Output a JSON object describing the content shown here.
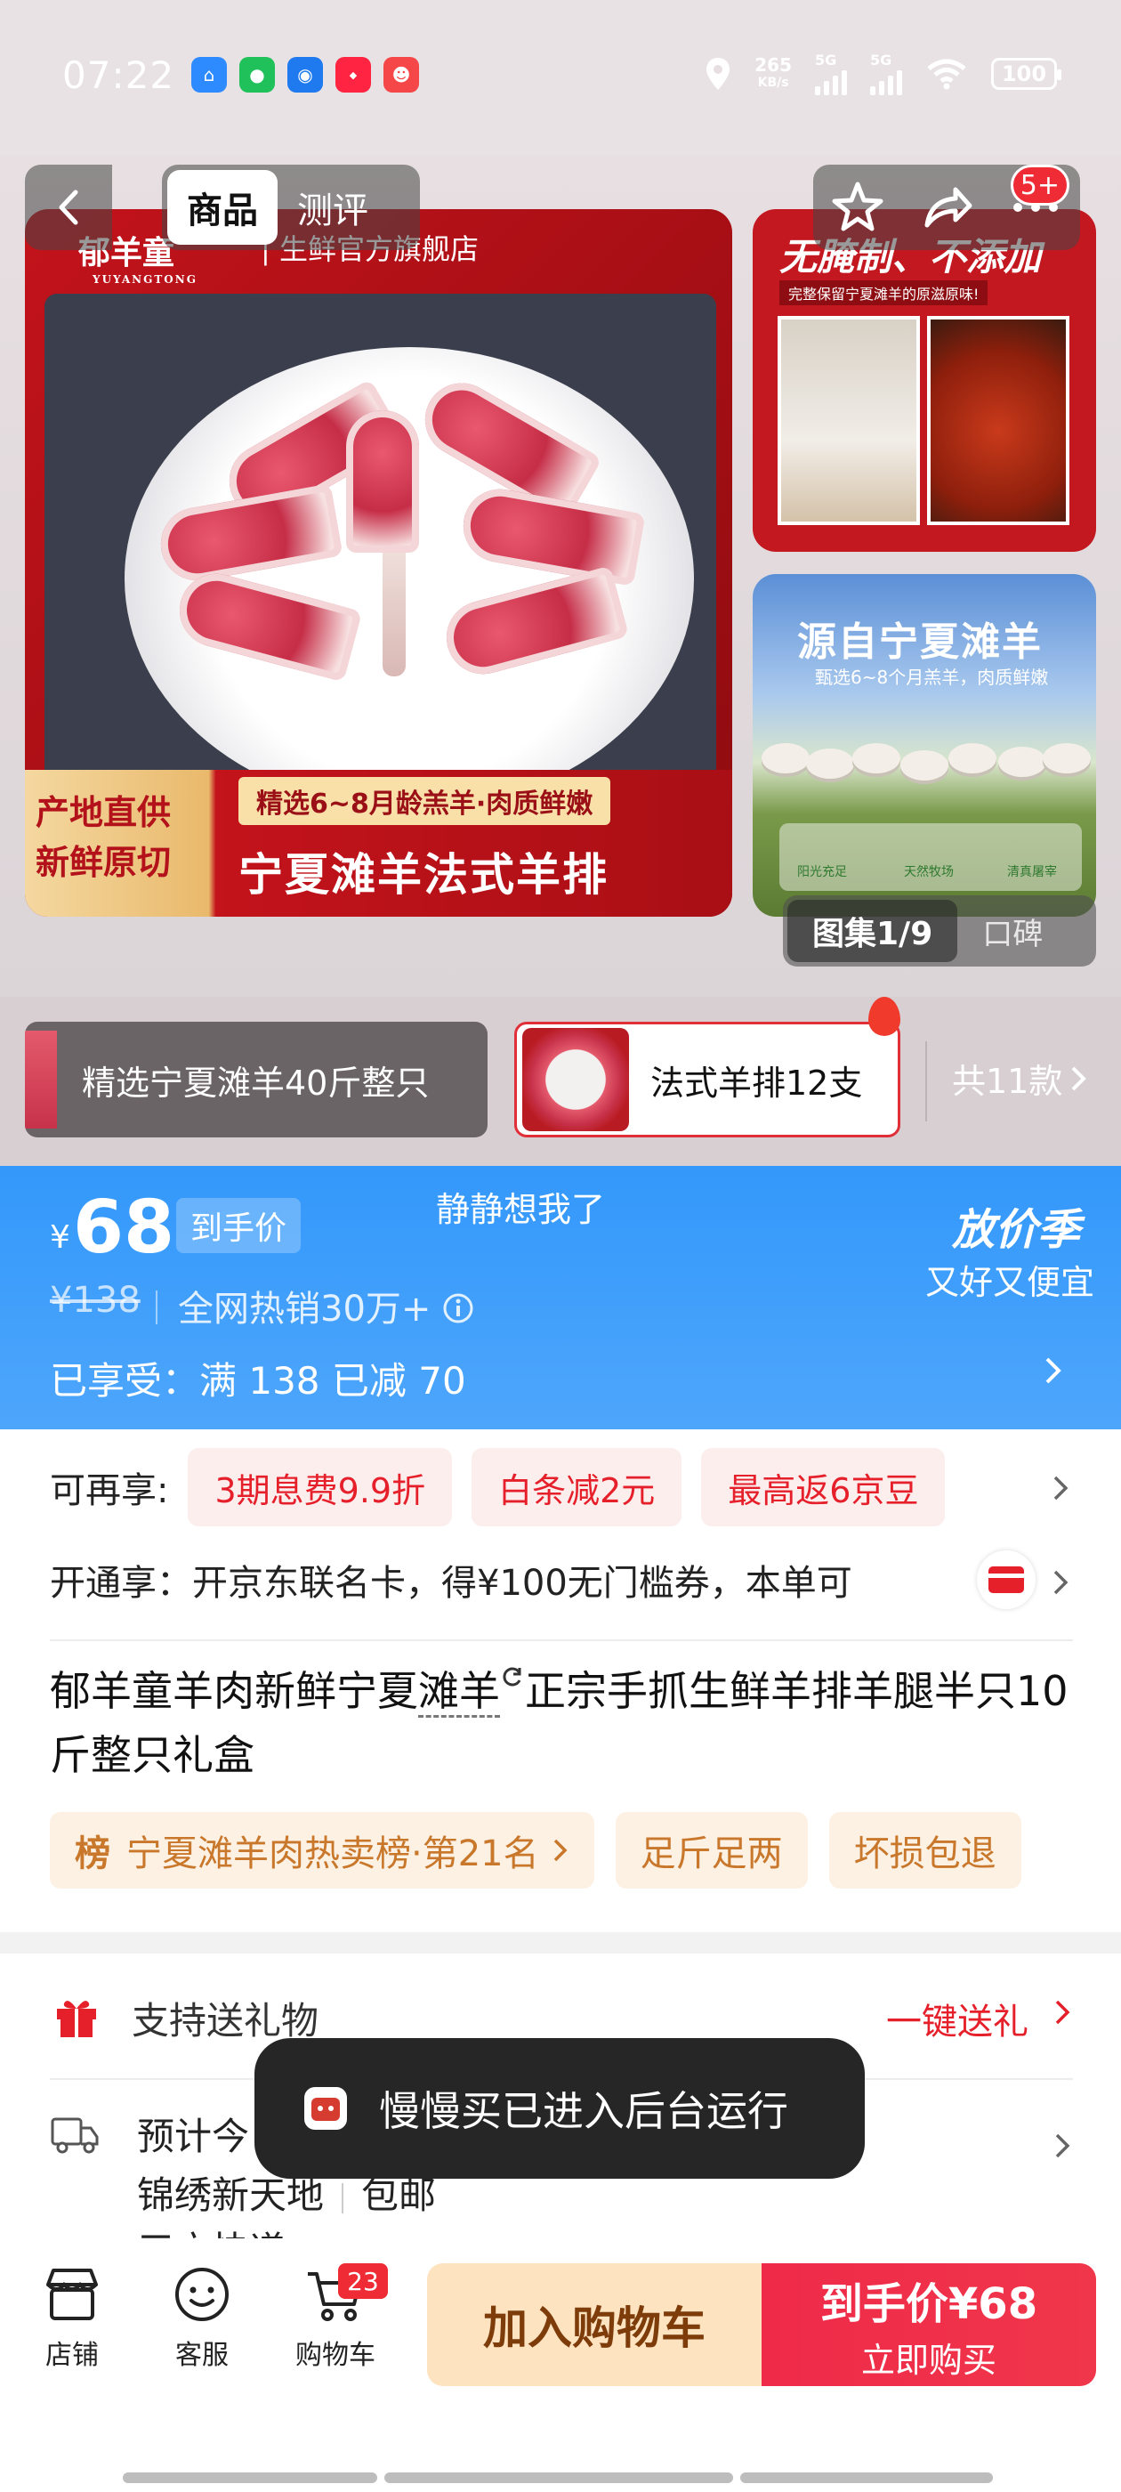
{
  "status_bar": {
    "time": "07:22",
    "speed_value": "265",
    "speed_unit": "KB/s",
    "sig1": "5G",
    "sig2": "5G",
    "battery": "100",
    "app_icons": [
      "home-app-icon",
      "wechat-icon",
      "message-app-icon",
      "xiaohongshu-icon",
      "game-app-icon"
    ]
  },
  "nav": {
    "tabs": [
      "商品",
      "测评"
    ],
    "active_tab": "商品",
    "more_badge": "5+"
  },
  "gallery": {
    "main": {
      "brand": "郁羊童",
      "brand_sub": "YUYANGTONG",
      "store": "| 生鲜官方旗舰店",
      "left_line1": "产地直供",
      "left_line2": "新鲜原切",
      "tagline": "精选6~8月龄羔羊·肉质鲜嫩",
      "headline": "宁夏滩羊法式羊排"
    },
    "side1": {
      "title": "无腌制、不添加",
      "subtitle": "完整保留宁夏滩羊的原滋原味!"
    },
    "side2": {
      "title": "源自宁夏滩羊",
      "subtitle": "甄选6~8个月羔羊，肉质鲜嫩",
      "badges": [
        "阳光充足",
        "天然牧场",
        "清真屠宰"
      ]
    },
    "album_label": "图集1/9",
    "review_label": "口碑"
  },
  "sku": {
    "card1": "精选宁夏滩羊40斤整只",
    "card2": "法式羊排12支",
    "more": "共11款"
  },
  "price": {
    "currency": "¥",
    "value": "68",
    "badge": "到手价",
    "tooltip": "静静想我了",
    "season_title": "放价季",
    "season_sub": "又好又便宜",
    "original": "¥138",
    "sold": "全网热销30万+",
    "enjoyed": "已享受：满 138 已减 70"
  },
  "offers": {
    "more_label": "可再享:",
    "chips": [
      "3期息费9.9折",
      "白条减2元",
      "最高返6京豆"
    ],
    "open_text": "开通享：开京东联名卡，得¥100无门槛券，本单可"
  },
  "product": {
    "title_part1": "郁羊童羊肉新鲜宁夏",
    "title_dotted": "滩羊",
    "title_part2": "正宗手抓生鲜羊排羊腿半只10斤整只礼盒",
    "rank_label": "榜",
    "rank": "宁夏滩羊肉热卖榜·第21名",
    "tags": [
      "足斤足两",
      "坏损包退"
    ]
  },
  "service": {
    "gift_label": "支持送礼物",
    "gift_cta": "一键送礼",
    "delivery_line1": "预计今",
    "delivery_addr": "锦绣新天地",
    "delivery_free": "包邮",
    "delivery_line3": "三方快递"
  },
  "toast": {
    "text": "慢慢买已进入后台运行"
  },
  "bottom": {
    "shop": "店铺",
    "service": "客服",
    "cart": "购物车",
    "cart_count": "23",
    "add_cart": "加入购物车",
    "buy_price": "到手价¥68",
    "buy_now": "立即购买"
  },
  "colors": {
    "accent_red": "#e5202b",
    "price_blue": "#3398fb",
    "cart_button": "#fde3c0",
    "buy_button": "#ef2a49"
  }
}
